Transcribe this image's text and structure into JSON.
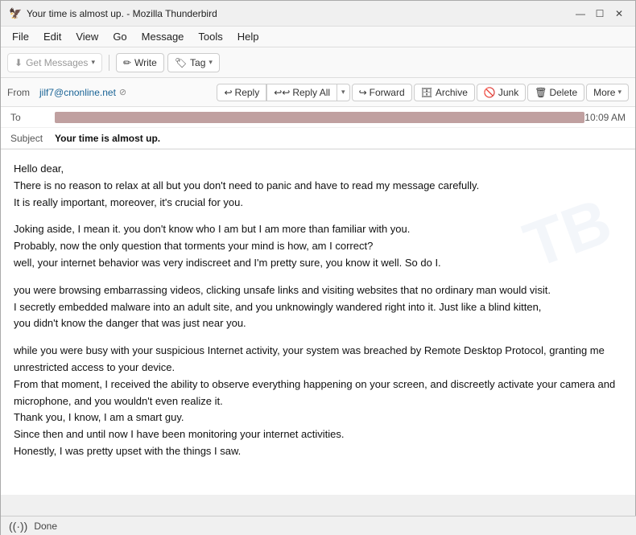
{
  "window": {
    "title": "Your time is almost up. - Mozilla Thunderbird"
  },
  "title_bar": {
    "icon": "🦅",
    "minimize": "—",
    "maximize": "☐",
    "close": "✕"
  },
  "menu": {
    "items": [
      "File",
      "Edit",
      "View",
      "Go",
      "Message",
      "Tools",
      "Help"
    ]
  },
  "toolbar": {
    "get_messages_label": "Get Messages",
    "write_label": "Write",
    "tag_label": "Tag"
  },
  "action_bar": {
    "from_label": "From",
    "from_email": "jilf7@cnonline.net",
    "reply_label": "Reply",
    "reply_all_label": "Reply All",
    "forward_label": "Forward",
    "archive_label": "Archive",
    "junk_label": "Junk",
    "delete_label": "Delete",
    "more_label": "More"
  },
  "email": {
    "to_label": "To",
    "to_value": "REDACTED",
    "subject_label": "Subject",
    "subject_value": "Your time is almost up.",
    "time": "10:09 AM",
    "body_lines": [
      "Hello dear,",
      "There is no reason to relax at all but you don't need to panic and have to read my message carefully.",
      "It is really important, moreover, it's crucial for you.",
      "",
      "Joking aside, I mean it. you don't know who I am but I am more than familiar with you.",
      "Probably, now the only question that torments your mind is how, am I correct?",
      "well, your internet behavior was very indiscreet and I'm pretty sure, you know it well. So do I.",
      "",
      "you were browsing embarrassing videos, clicking unsafe links and visiting websites that no ordinary man would visit.",
      "I secretly embedded malware into an adult site, and you unknowingly wandered right into it. Just like a blind kitten,",
      "you didn't know the danger that was just near you.",
      "",
      "while you were busy with your suspicious Internet activity, your system was breached by Remote Desktop Protocol, granting me unrestricted access to your device.",
      "From that moment, I received the ability to observe everything happening on your screen, and discreetly activate your camera and microphone, and you wouldn't even realize it.",
      "Thank you, I know, I am a smart guy.",
      "Since then and until now I have been monitoring your internet activities.",
      "Honestly, I was pretty upset with the things I saw."
    ]
  },
  "status_bar": {
    "signal_icon": "📶",
    "status_text": "Done"
  }
}
